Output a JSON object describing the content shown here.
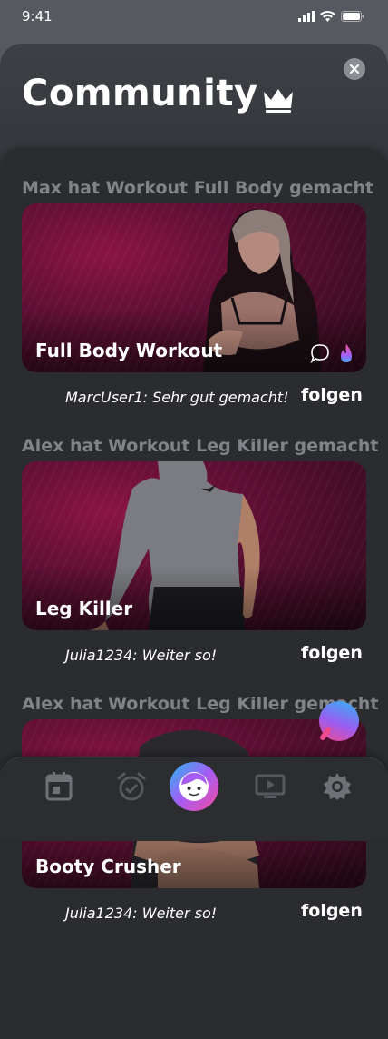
{
  "status_bar": {
    "time": "9:41"
  },
  "header": {
    "title": "Community"
  },
  "colors": {
    "accent_gradient_start": "#24b7f0",
    "accent_gradient_mid": "#a55df4",
    "accent_gradient_end": "#f14ba0",
    "card_base": "#5e0f33",
    "heading_gray": "#808388"
  },
  "feed": [
    {
      "heading": "Max hat Workout Full Body gemacht",
      "card_title": "Full Body Workout",
      "comment": "MarcUser1: Sehr gut gemacht!",
      "follow_label": "folgen",
      "icons": [
        "comment-icon",
        "flame-icon"
      ]
    },
    {
      "heading": "Alex hat Workout Leg Killer gemacht",
      "card_title": "Leg Killer",
      "comment": "Julia1234: Weiter so!",
      "follow_label": "folgen"
    },
    {
      "heading": "Alex hat Workout Leg Killer gemacht",
      "card_title": "Booty Crusher",
      "comment": "Julia1234: Weiter so!",
      "follow_label": "folgen"
    }
  ],
  "nav": {
    "items": [
      "calendar-icon",
      "alarm-icon",
      "profile-face-icon",
      "video-icon",
      "settings-icon"
    ],
    "active": "profile-face-icon"
  }
}
